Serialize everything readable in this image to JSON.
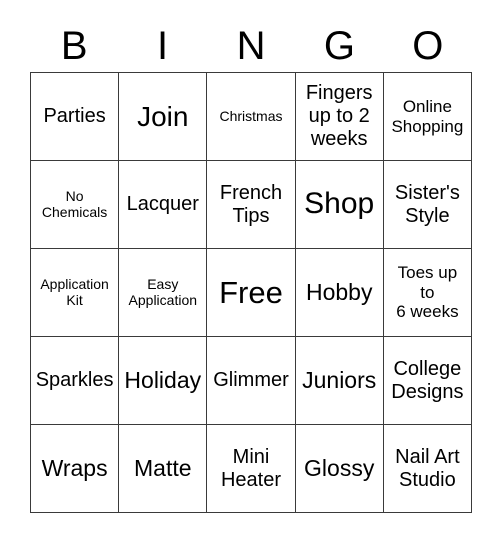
{
  "card": {
    "type": "bingo-card",
    "header_letters": [
      "B",
      "I",
      "N",
      "G",
      "O"
    ],
    "columns": 5,
    "rows": 5,
    "border_color": "#3a3a3a",
    "background_color": "#ffffff",
    "text_color": "#000000",
    "free_space": "Free",
    "cells": [
      {
        "text": "Parties",
        "size": "fs-m"
      },
      {
        "text": "Join",
        "size": "fs-xl"
      },
      {
        "text": "Christmas",
        "size": "fs-xs"
      },
      {
        "text": "Fingers\nup to 2\nweeks",
        "size": "fs-m"
      },
      {
        "text": "Online\nShopping",
        "size": "fs-s"
      },
      {
        "text": "No\nChemicals",
        "size": "fs-xs"
      },
      {
        "text": "Lacquer",
        "size": "fs-m"
      },
      {
        "text": "French\nTips",
        "size": "fs-m"
      },
      {
        "text": "Shop",
        "size": "fs-xxl"
      },
      {
        "text": "Sister's\nStyle",
        "size": "fs-m"
      },
      {
        "text": "Application\nKit",
        "size": "fs-xs"
      },
      {
        "text": "Easy\nApplication",
        "size": "fs-xs"
      },
      {
        "text": "Free",
        "size": "fs-free"
      },
      {
        "text": "Hobby",
        "size": "fs-l"
      },
      {
        "text": "Toes up\nto\n6 weeks",
        "size": "fs-s"
      },
      {
        "text": "Sparkles",
        "size": "fs-m"
      },
      {
        "text": "Holiday",
        "size": "fs-l"
      },
      {
        "text": "Glimmer",
        "size": "fs-m"
      },
      {
        "text": "Juniors",
        "size": "fs-l"
      },
      {
        "text": "College\nDesigns",
        "size": "fs-m"
      },
      {
        "text": "Wraps",
        "size": "fs-l"
      },
      {
        "text": "Matte",
        "size": "fs-l"
      },
      {
        "text": "Mini\nHeater",
        "size": "fs-m"
      },
      {
        "text": "Glossy",
        "size": "fs-l"
      },
      {
        "text": "Nail Art\nStudio",
        "size": "fs-m"
      }
    ]
  }
}
